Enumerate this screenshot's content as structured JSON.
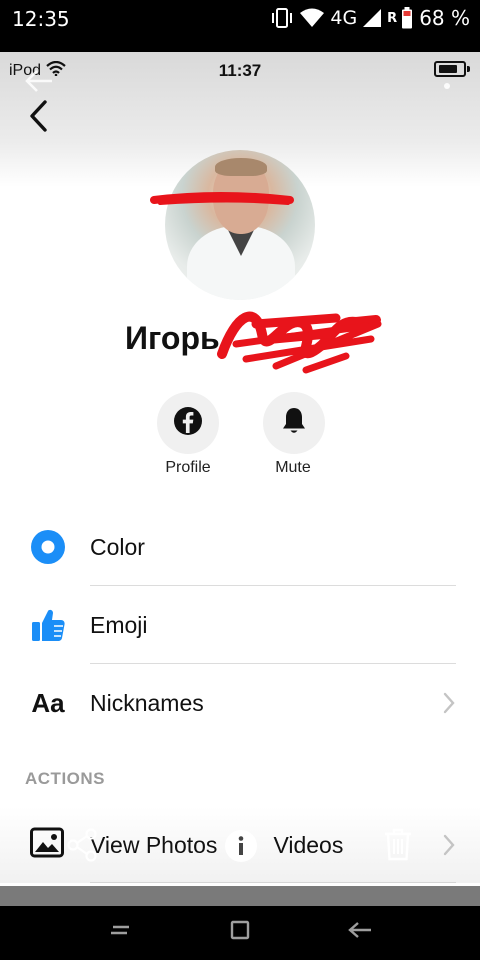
{
  "android_status": {
    "time": "12:35",
    "network": "4G",
    "roaming": "R",
    "battery": "68 %"
  },
  "ios_status": {
    "carrier": "iPod",
    "time": "11:37"
  },
  "profile": {
    "name": "Игорь"
  },
  "quick_actions": [
    {
      "label": "Profile",
      "icon": "facebook-icon"
    },
    {
      "label": "Mute",
      "icon": "bell-icon"
    }
  ],
  "settings": [
    {
      "label": "Color",
      "icon": "color-dot-icon"
    },
    {
      "label": "Emoji",
      "icon": "thumbs-up-icon"
    },
    {
      "label": "Nicknames",
      "icon": "text-aa-icon",
      "icon_text": "Aa"
    }
  ],
  "actions": {
    "title": "ACTIONS",
    "items": [
      {
        "label": "View Photos & Videos",
        "visible_parts": [
          "View Photos",
          "Videos"
        ]
      }
    ]
  },
  "colors": {
    "accent_blue": "#1b8ef7",
    "scribble_red": "#e8141b"
  }
}
